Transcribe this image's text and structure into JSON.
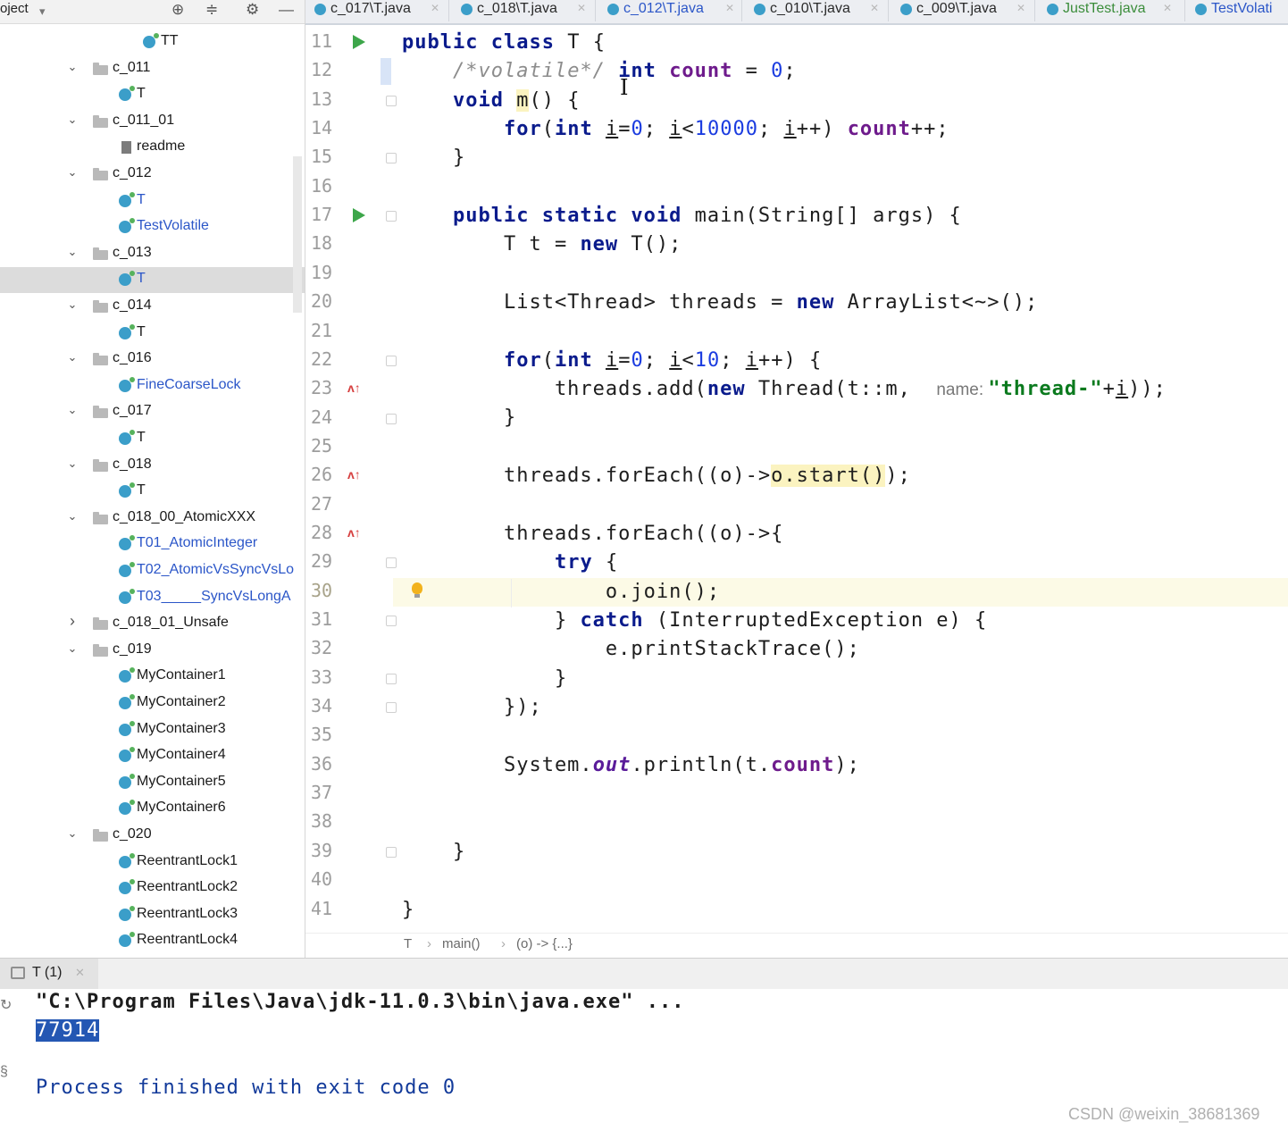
{
  "project_panel": {
    "title": "oject",
    "tool_icons": [
      "crosshair-icon",
      "collapse-icon",
      "gear-icon",
      "minimize-icon"
    ],
    "items": [
      {
        "label": "TT",
        "type": "class",
        "indent": 2
      },
      {
        "label": "c_011",
        "type": "package",
        "indent": 1,
        "expanded": true
      },
      {
        "label": "T",
        "type": "class",
        "indent": 2
      },
      {
        "label": "c_011_01",
        "type": "package",
        "indent": 1,
        "expanded": true
      },
      {
        "label": "readme",
        "type": "file",
        "indent": 2
      },
      {
        "label": "c_012",
        "type": "package",
        "indent": 1,
        "expanded": true
      },
      {
        "label": "T",
        "type": "class",
        "indent": 2,
        "modified": true
      },
      {
        "label": "TestVolatile",
        "type": "class",
        "indent": 2,
        "modified": true
      },
      {
        "label": "c_013",
        "type": "package",
        "indent": 1,
        "expanded": true
      },
      {
        "label": "T",
        "type": "class",
        "indent": 2,
        "modified": true,
        "selected": true
      },
      {
        "label": "c_014",
        "type": "package",
        "indent": 1,
        "expanded": true
      },
      {
        "label": "T",
        "type": "class",
        "indent": 2
      },
      {
        "label": "c_016",
        "type": "package",
        "indent": 1,
        "expanded": true
      },
      {
        "label": "FineCoarseLock",
        "type": "class",
        "indent": 2,
        "modified": true
      },
      {
        "label": "c_017",
        "type": "package",
        "indent": 1,
        "expanded": true
      },
      {
        "label": "T",
        "type": "class",
        "indent": 2
      },
      {
        "label": "c_018",
        "type": "package",
        "indent": 1,
        "expanded": true
      },
      {
        "label": "T",
        "type": "class",
        "indent": 2
      },
      {
        "label": "c_018_00_AtomicXXX",
        "type": "package",
        "indent": 1,
        "expanded": true
      },
      {
        "label": "T01_AtomicInteger",
        "type": "class",
        "indent": 2,
        "modified": true
      },
      {
        "label": "T02_AtomicVsSyncVsLo",
        "type": "class",
        "indent": 2,
        "modified": true
      },
      {
        "label": "T03_____SyncVsLongA",
        "type": "class",
        "indent": 2,
        "modified": true
      },
      {
        "label": "c_018_01_Unsafe",
        "type": "package",
        "indent": 1,
        "expanded": false
      },
      {
        "label": "c_019",
        "type": "package",
        "indent": 1,
        "expanded": true
      },
      {
        "label": "MyContainer1",
        "type": "class",
        "indent": 2
      },
      {
        "label": "MyContainer2",
        "type": "class",
        "indent": 2
      },
      {
        "label": "MyContainer3",
        "type": "class",
        "indent": 2
      },
      {
        "label": "MyContainer4",
        "type": "class",
        "indent": 2
      },
      {
        "label": "MyContainer5",
        "type": "class",
        "indent": 2
      },
      {
        "label": "MyContainer6",
        "type": "class",
        "indent": 2
      },
      {
        "label": "c_020",
        "type": "package",
        "indent": 1,
        "expanded": true
      },
      {
        "label": "ReentrantLock1",
        "type": "class",
        "indent": 2
      },
      {
        "label": "ReentrantLock2",
        "type": "class",
        "indent": 2
      },
      {
        "label": "ReentrantLock3",
        "type": "class",
        "indent": 2
      },
      {
        "label": "ReentrantLock4",
        "type": "class",
        "indent": 2
      }
    ]
  },
  "tabs": [
    {
      "label": "c_017\\T.java",
      "style": "normal"
    },
    {
      "label": "c_018\\T.java",
      "style": "normal"
    },
    {
      "label": "c_012\\T.java",
      "style": "blue"
    },
    {
      "label": "c_010\\T.java",
      "style": "normal"
    },
    {
      "label": "c_009\\T.java",
      "style": "normal"
    },
    {
      "label": "JustTest.java",
      "style": "green"
    },
    {
      "label": "TestVolati",
      "style": "blue"
    }
  ],
  "editor": {
    "line_numbers": [
      "11",
      "12",
      "13",
      "14",
      "15",
      "16",
      "17",
      "18",
      "19",
      "20",
      "21",
      "22",
      "23",
      "24",
      "25",
      "26",
      "27",
      "28",
      "29",
      "30",
      "31",
      "32",
      "33",
      "34",
      "35",
      "36",
      "37",
      "38",
      "39",
      "40",
      "41"
    ],
    "current_line": "30",
    "breadcrumbs": [
      "T",
      "main()",
      "(o) -> {...}"
    ]
  },
  "run_panel": {
    "tab_label": "T (1)",
    "command": "\"C:\\Program Files\\Java\\jdk-11.0.3\\bin\\java.exe\" ...",
    "output": "77914",
    "finish": "Process finished with exit code 0"
  },
  "watermark": "CSDN @weixin_38681369",
  "colors": {
    "keyword": "#0a1b8c",
    "number": "#1b3ce0",
    "string": "#0b7a1e",
    "field": "#6e1b8c",
    "selection": "#2457b3",
    "current_line": "#fcfae6"
  }
}
